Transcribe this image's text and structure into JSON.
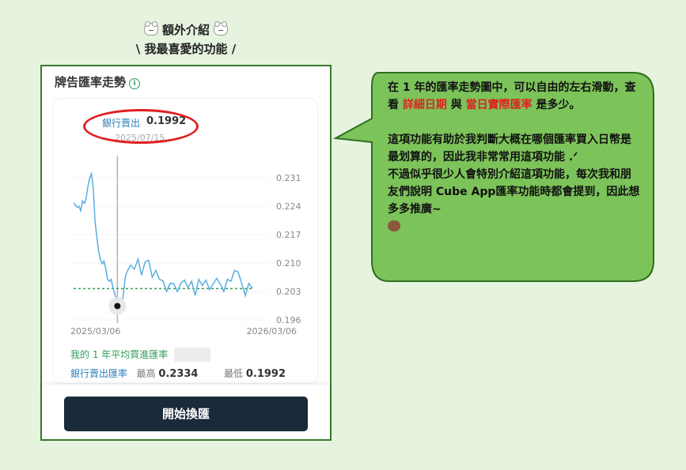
{
  "heading": {
    "line1": "額外介紹",
    "line2": "\\ 我最喜愛的功能 /"
  },
  "panel": {
    "title": "牌告匯率走勢",
    "tooltip": {
      "label": "銀行賣出",
      "value": "0.1992",
      "date": "2025/07/15"
    },
    "avg_label": "我的 1 年平均買進匯率",
    "hl_label": "銀行賣出匯率",
    "high_label": "最高",
    "high_value": "0.2334",
    "low_label": "最低",
    "low_value": "0.1992",
    "button_label": "開始換匯"
  },
  "chart_data": {
    "type": "line",
    "y_ticks": [
      "0.231",
      "0.224",
      "0.217",
      "0.210",
      "0.203",
      "0.196"
    ],
    "x_labels": [
      "2025/03/06",
      "2026/03/06"
    ],
    "ylim": [
      0.196,
      0.231
    ],
    "average_line": 0.2037,
    "selected_x": 0.245,
    "x": [
      0,
      0.01,
      0.02,
      0.03,
      0.04,
      0.05,
      0.06,
      0.07,
      0.08,
      0.09,
      0.1,
      0.11,
      0.12,
      0.13,
      0.14,
      0.15,
      0.16,
      0.17,
      0.18,
      0.19,
      0.2,
      0.21,
      0.22,
      0.23,
      0.24,
      0.25,
      0.26,
      0.27,
      0.28,
      0.29,
      0.3,
      0.32,
      0.34,
      0.36,
      0.38,
      0.4,
      0.42,
      0.44,
      0.46,
      0.48,
      0.5,
      0.52,
      0.54,
      0.56,
      0.58,
      0.6,
      0.62,
      0.64,
      0.66,
      0.68,
      0.7,
      0.72,
      0.74,
      0.76,
      0.78,
      0.8,
      0.82,
      0.84,
      0.86,
      0.88,
      0.9,
      0.92,
      0.94,
      0.96,
      0.98,
      1.0
    ],
    "values": [
      0.2248,
      0.2243,
      0.2237,
      0.224,
      0.2229,
      0.2253,
      0.2247,
      0.2259,
      0.2288,
      0.231,
      0.232,
      0.2283,
      0.2204,
      0.2163,
      0.213,
      0.2108,
      0.2098,
      0.2105,
      0.2085,
      0.206,
      0.2055,
      0.206,
      0.204,
      0.2025,
      0.201,
      0.1998,
      0.2012,
      0.1996,
      0.203,
      0.2068,
      0.208,
      0.2095,
      0.2085,
      0.211,
      0.207,
      0.2103,
      0.2107,
      0.2065,
      0.2082,
      0.206,
      0.2056,
      0.203,
      0.205,
      0.2049,
      0.203,
      0.205,
      0.2058,
      0.204,
      0.2055,
      0.202,
      0.206,
      0.2045,
      0.2058,
      0.2035,
      0.2048,
      0.2062,
      0.2049,
      0.203,
      0.206,
      0.2055,
      0.2082,
      0.2078,
      0.205,
      0.202,
      0.205,
      0.2038
    ]
  },
  "bubble": {
    "p1_a": "在 1 年的匯率走勢圖中，可以自由的左右滑動，查看",
    "p1_red1": "詳細日期",
    "p1_and": "與",
    "p1_red2": "當日實際匯率",
    "p1_end": "是多少。",
    "p2": "這項功能有助於我判斷大概在哪個匯率買入日幣是最划算的，因此我非常常用這項功能 .ᐟ",
    "p3": "不過似乎很少人會特別介紹這項功能，每次我和朋友們說明 Cube App匯率功能時都會提到，因此想多多推廣~"
  },
  "colors": {
    "bubble_fill": "#7cc35a",
    "bubble_border": "#2f6e1f",
    "line": "#5aaee0",
    "avg_line": "#2e9e55",
    "accent_red": "#e02020",
    "button": "#1a2a3a"
  }
}
